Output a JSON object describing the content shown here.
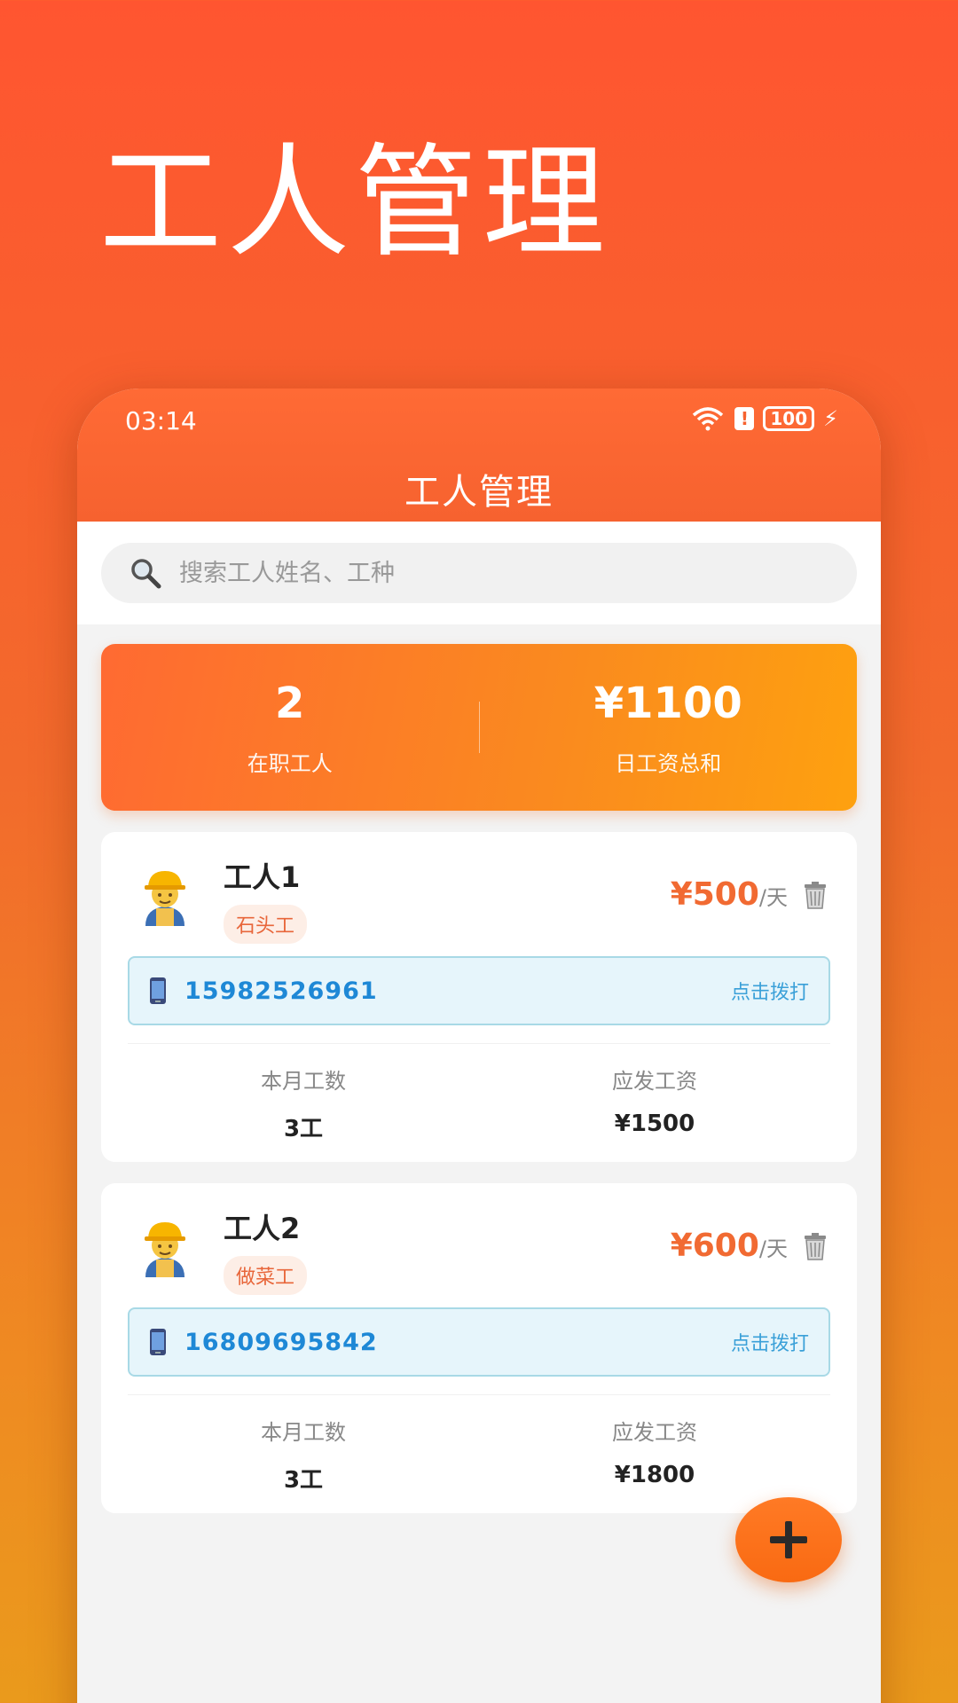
{
  "promo": {
    "title": "工人管理"
  },
  "status_bar": {
    "time": "03:14",
    "battery": "100"
  },
  "header": {
    "title": "工人管理"
  },
  "search": {
    "placeholder": "搜索工人姓名、工种"
  },
  "stats": {
    "worker_count": "2",
    "worker_count_label": "在职工人",
    "daily_total": "¥1100",
    "daily_total_label": "日工资总和"
  },
  "workers": [
    {
      "name": "工人1",
      "trade": "石头工",
      "wage": "¥500",
      "wage_unit": "/天",
      "phone": "15982526961",
      "call_label": "点击拨打",
      "days_label": "本月工数",
      "days_value": "3工",
      "pay_label": "应发工资",
      "pay_value": "¥1500"
    },
    {
      "name": "工人2",
      "trade": "做菜工",
      "wage": "¥600",
      "wage_unit": "/天",
      "phone": "16809695842",
      "call_label": "点击拨打",
      "days_label": "本月工数",
      "days_value": "3工",
      "pay_label": "应发工资",
      "pay_value": "¥1800"
    }
  ],
  "colors": {
    "accent": "#f6622f",
    "phone_blue": "#1e88d6",
    "tag_bg": "#fdeee6"
  },
  "icons": {
    "search": "search-icon",
    "avatar": "construction-worker-icon",
    "delete": "trash-icon",
    "phone": "mobile-phone-icon",
    "add": "plus-icon"
  }
}
